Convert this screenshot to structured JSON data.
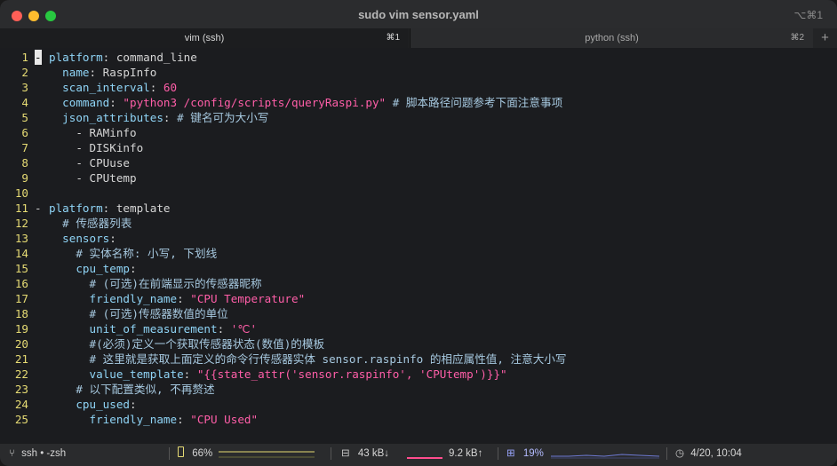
{
  "window": {
    "title": "sudo vim sensor.yaml",
    "shortcut": "⌥⌘1"
  },
  "tabs": [
    {
      "label": "vim (ssh)",
      "shortcut": "⌘1",
      "active": true
    },
    {
      "label": "python (ssh)",
      "shortcut": "⌘2",
      "active": false
    }
  ],
  "tab_add": "+",
  "editor": {
    "lines": [
      {
        "n": "1",
        "fold": "-",
        "tokens": [
          {
            "t": "- ",
            "c": "p"
          },
          {
            "t": "platform",
            "c": "kb"
          },
          {
            "t": ": command_line",
            "c": "p"
          }
        ]
      },
      {
        "n": "2",
        "fold": "",
        "tokens": [
          {
            "t": "  ",
            "c": "p"
          },
          {
            "t": "name",
            "c": "kb"
          },
          {
            "t": ": RaspInfo",
            "c": "p"
          }
        ]
      },
      {
        "n": "3",
        "fold": "",
        "tokens": [
          {
            "t": "  ",
            "c": "p"
          },
          {
            "t": "scan_interval",
            "c": "kb"
          },
          {
            "t": ": ",
            "c": "p"
          },
          {
            "t": "60",
            "c": "num"
          }
        ]
      },
      {
        "n": "4",
        "fold": "",
        "tokens": [
          {
            "t": "  ",
            "c": "p"
          },
          {
            "t": "command",
            "c": "kb"
          },
          {
            "t": ": ",
            "c": "p"
          },
          {
            "t": "\"python3 /config/scripts/queryRaspi.py\"",
            "c": "str"
          },
          {
            "t": " # 脚本路径问题参考下面注意事项",
            "c": "cm"
          }
        ]
      },
      {
        "n": "5",
        "fold": "",
        "tokens": [
          {
            "t": "  ",
            "c": "p"
          },
          {
            "t": "json_attributes",
            "c": "kb"
          },
          {
            "t": ": ",
            "c": "p"
          },
          {
            "t": "# 键名可为大小写",
            "c": "cm"
          }
        ]
      },
      {
        "n": "6",
        "fold": "",
        "tokens": [
          {
            "t": "    - RAMinfo",
            "c": "p"
          }
        ]
      },
      {
        "n": "7",
        "fold": "",
        "tokens": [
          {
            "t": "    - DISKinfo",
            "c": "p"
          }
        ]
      },
      {
        "n": "8",
        "fold": "",
        "tokens": [
          {
            "t": "    - CPUuse",
            "c": "p"
          }
        ]
      },
      {
        "n": "9",
        "fold": "",
        "tokens": [
          {
            "t": "    - CPUtemp",
            "c": "p"
          }
        ]
      },
      {
        "n": "10",
        "fold": "",
        "tokens": []
      },
      {
        "n": "11",
        "fold": "-",
        "tokens": [
          {
            "t": "- ",
            "c": "p"
          },
          {
            "t": "platform",
            "c": "kb"
          },
          {
            "t": ": template",
            "c": "p"
          }
        ]
      },
      {
        "n": "12",
        "fold": "",
        "tokens": [
          {
            "t": "  # 传感器列表",
            "c": "cm"
          }
        ]
      },
      {
        "n": "13",
        "fold": "",
        "tokens": [
          {
            "t": "  ",
            "c": "p"
          },
          {
            "t": "sensors",
            "c": "kb"
          },
          {
            "t": ":",
            "c": "p"
          }
        ]
      },
      {
        "n": "14",
        "fold": "",
        "tokens": [
          {
            "t": "    # 实体名称: 小写, 下划线",
            "c": "cm"
          }
        ]
      },
      {
        "n": "15",
        "fold": "",
        "tokens": [
          {
            "t": "    ",
            "c": "p"
          },
          {
            "t": "cpu_temp",
            "c": "kb"
          },
          {
            "t": ":",
            "c": "p"
          }
        ]
      },
      {
        "n": "16",
        "fold": "",
        "tokens": [
          {
            "t": "      # (可选)在前端显示的传感器昵称",
            "c": "cm"
          }
        ]
      },
      {
        "n": "17",
        "fold": "",
        "tokens": [
          {
            "t": "      ",
            "c": "p"
          },
          {
            "t": "friendly_name",
            "c": "kb"
          },
          {
            "t": ": ",
            "c": "p"
          },
          {
            "t": "\"CPU Temperature\"",
            "c": "str"
          }
        ]
      },
      {
        "n": "18",
        "fold": "",
        "tokens": [
          {
            "t": "      # (可选)传感器数值的单位",
            "c": "cm"
          }
        ]
      },
      {
        "n": "19",
        "fold": "",
        "tokens": [
          {
            "t": "      ",
            "c": "p"
          },
          {
            "t": "unit_of_measurement",
            "c": "kb"
          },
          {
            "t": ": ",
            "c": "p"
          },
          {
            "t": "'℃'",
            "c": "str"
          }
        ]
      },
      {
        "n": "20",
        "fold": "",
        "tokens": [
          {
            "t": "      #(必须)定义一个获取传感器状态(数值)的模板",
            "c": "cm"
          }
        ]
      },
      {
        "n": "21",
        "fold": "",
        "tokens": [
          {
            "t": "      # 这里就是获取上面定义的命令行传感器实体 sensor.raspinfo 的相应属性值, 注意大小写",
            "c": "cm"
          }
        ]
      },
      {
        "n": "22",
        "fold": "",
        "tokens": [
          {
            "t": "      ",
            "c": "p"
          },
          {
            "t": "value_template",
            "c": "kb"
          },
          {
            "t": ": ",
            "c": "p"
          },
          {
            "t": "\"{{state_attr('sensor.raspinfo', 'CPUtemp')}}\"",
            "c": "str"
          }
        ]
      },
      {
        "n": "23",
        "fold": "",
        "tokens": [
          {
            "t": "    # 以下配置类似, 不再赘述",
            "c": "cm"
          }
        ]
      },
      {
        "n": "24",
        "fold": "",
        "tokens": [
          {
            "t": "    ",
            "c": "p"
          },
          {
            "t": "cpu_used",
            "c": "kb"
          },
          {
            "t": ":",
            "c": "p"
          }
        ]
      },
      {
        "n": "25",
        "fold": "",
        "tokens": [
          {
            "t": "      ",
            "c": "p"
          },
          {
            "t": "friendly_name",
            "c": "kb"
          },
          {
            "t": ": ",
            "c": "p"
          },
          {
            "t": "\"CPU Used\"",
            "c": "str"
          }
        ]
      }
    ]
  },
  "status": {
    "session": "ssh • -zsh",
    "battery": "66%",
    "battery_level": 0.66,
    "net_down": "43 kB↓",
    "net_up": "9.2 kB↑",
    "cpu": "19%",
    "clock": "4/20, 10:04"
  },
  "colors": {
    "accent_line_numbers": "#e6db74",
    "keys": "#8fd4f6",
    "strings": "#ff5ea8",
    "comments": "#a6c8df"
  }
}
